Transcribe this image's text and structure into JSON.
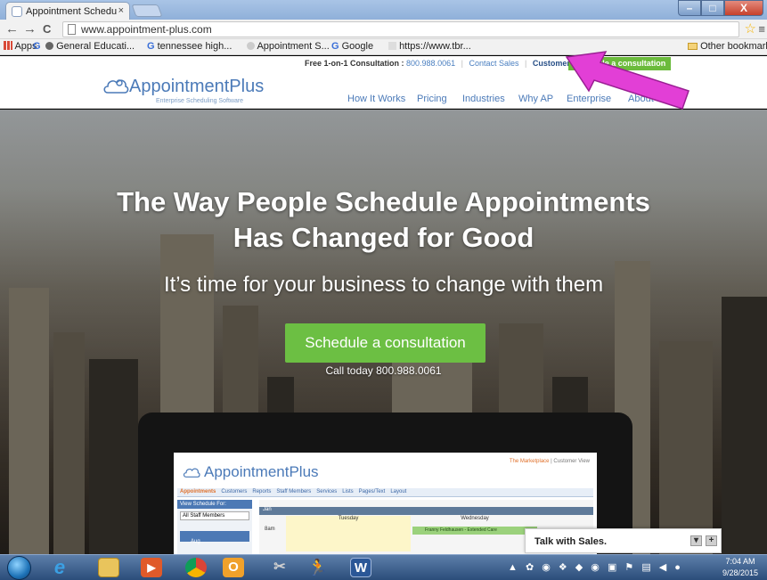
{
  "browser": {
    "tab_title": "Appointment Schedu",
    "tab_close": "×",
    "url": "www.appointment-plus.com",
    "nav_back": "←",
    "nav_forward": "→",
    "nav_reload": "C",
    "star": "☆",
    "menu": "≡",
    "win_min": "–",
    "win_max": "□",
    "win_close": "X"
  },
  "bookmarks": {
    "apps": "Apps",
    "g_glyph": "G",
    "items": [
      "General Educati...",
      "tennessee high...",
      "Appointment S...",
      "Google",
      "https://www.tbr..."
    ],
    "other": "Other bookmarks"
  },
  "site": {
    "consult_prefix": "Free 1-on-1 Consultation :",
    "phone": "800.988.0061",
    "contact_sales": "Contact Sales",
    "customer_login": "Customer Login",
    "cta_top": "Schedule a consultation",
    "logo_text": "AppointmentPlus",
    "logo_tm": "·",
    "logo_tagline": "Enterprise Scheduling Software",
    "nav": [
      "How It Works",
      "Pricing",
      "Industries",
      "Why AP",
      "Enterprise",
      "About"
    ]
  },
  "hero": {
    "title_line1": "The Way People Schedule Appointments",
    "title_line2": "Has Changed for Good",
    "subtitle": "It’s time for your business to change with them",
    "cta": "Schedule a consultation",
    "call": "Call today 800.988.0061"
  },
  "laptop": {
    "logo": "AppointmentPlus",
    "marketplace": "The Marketplace",
    "customer_view": "Customer View",
    "tabs": [
      "Appointments",
      "Customers",
      "Reports",
      "Staff Members",
      "Services",
      "Lists",
      "Pages/Text",
      "Layout"
    ],
    "view_schedule": "View Schedule For:",
    "staff_select": "All Staff Members",
    "month_label": "Aug",
    "jan_label": "Jan",
    "day1": "Tuesday",
    "day2": "Wednesday",
    "time_8": "8am",
    "appt": "Franny Feldhausen - Extended Care"
  },
  "chat": {
    "label": "Talk with Sales.",
    "minimize": "▾",
    "expand": "+"
  },
  "taskbar": {
    "time": "7:04 AM",
    "date": "9/28/2015",
    "word_letter": "W",
    "outlook_letter": "O"
  },
  "colors": {
    "accent_green": "#6cbf43",
    "brand_blue": "#4b7ab8",
    "annotation_magenta": "#e23fd6"
  }
}
